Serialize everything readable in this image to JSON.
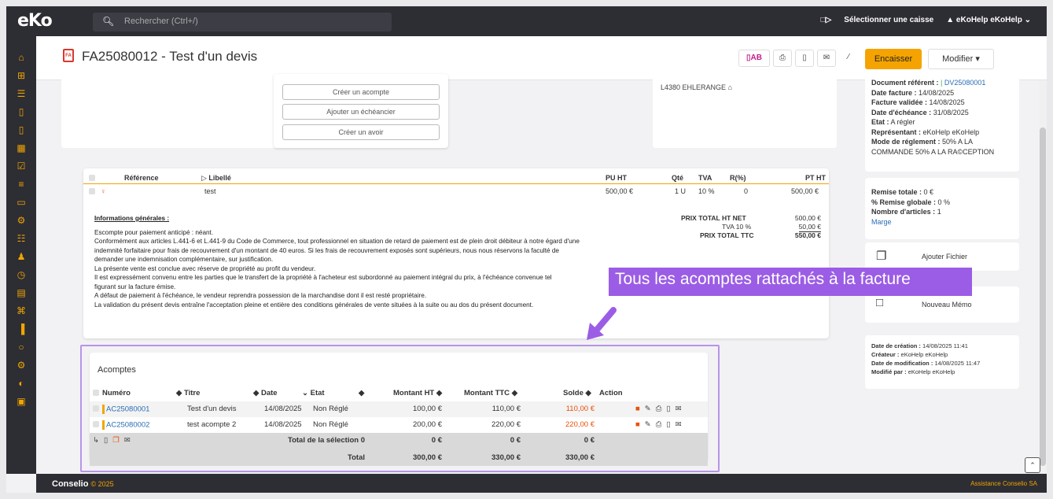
{
  "app": {
    "logo": "eKo",
    "search_placeholder": "Rechercher (Ctrl+/)",
    "select_register": "Sélectionner une caisse",
    "user": "eKoHelp eKoHelp"
  },
  "sidebar": {
    "icons": [
      "home-icon",
      "grid-icon",
      "list-icon",
      "document-icon",
      "document-add-icon",
      "calendar-icon",
      "calendar-check-icon",
      "list-numbered-icon",
      "folder-icon",
      "settings-list-icon",
      "sitemap-icon",
      "people-icon",
      "clock-icon",
      "receipt-icon",
      "network-icon",
      "chart-icon",
      "search-icon",
      "gear-icon",
      "palette-icon",
      "calculator-icon"
    ]
  },
  "header": {
    "title": "FA25080012 - Test d'un devis",
    "ab": "AB",
    "encaisser": "Encaisser",
    "modifier": "Modifier"
  },
  "actions": {
    "acompte": "Créer un acompte",
    "echeancier": "Ajouter un échéancier",
    "avoir": "Créer un avoir"
  },
  "address": {
    "city": "L4380 EHLERANGE"
  },
  "info": {
    "doc_ref_label": "Document référent :",
    "doc_ref": "DV25080001",
    "date_facture_label": "Date facture :",
    "date_facture": "14/08/2025",
    "validee_label": "Facture validée :",
    "validee": "14/08/2025",
    "echeance_label": "Date d'échéance :",
    "echeance": "31/08/2025",
    "etat_label": "Etat :",
    "etat": "A régler",
    "rep_label": "Représentant :",
    "rep": "eKoHelp eKoHelp",
    "mode_label": "Mode de réglement :",
    "mode": "50% A  LA COMMANDE 50% A  LA RA©CEPTION"
  },
  "totals_side": {
    "remise_label": "Remise totale :",
    "remise": "0 €",
    "remise_glob_label": "% Remise globale :",
    "remise_glob": "0 %",
    "nb_label": "Nombre d'articles :",
    "nb": "1",
    "marge": "Marge"
  },
  "ajouter_fichier": "Ajouter Fichier",
  "nouveau_memo": "Nouveau Mémo",
  "meta": {
    "creation_label": "Date de création :",
    "creation": "14/08/2025 11:41",
    "createur_label": "Créateur :",
    "createur": "eKoHelp eKoHelp",
    "modif_label": "Date de modification :",
    "modif": "14/08/2025 11:47",
    "modifie_label": "Modifié par :",
    "modifie": "eKoHelp eKoHelp"
  },
  "lines": {
    "headers": {
      "ref": "Référence",
      "lib": "Libellé",
      "pu": "PU HT",
      "qte": "Qté",
      "tva": "TVA",
      "r": "R(%)",
      "pt": "PT HT"
    },
    "row": {
      "lib": "test",
      "pu": "500,00 €",
      "qte": "1 U",
      "tva": "10 %",
      "r": "0",
      "pt": "500,00 €"
    }
  },
  "summary": {
    "net_label": "PRIX TOTAL HT NET",
    "net": "500,00 €",
    "tva_label": "TVA 10 %",
    "tva": "50,00 €",
    "ttc_label": "PRIX TOTAL TTC",
    "ttc": "550,00 €"
  },
  "general": {
    "title": "Informations générales :",
    "l1": "Escompte pour paiement anticipé : néant.",
    "l2": "Conformément aux articles L.441-6 et L.441-9 du Code de Commerce, tout professionnel en situation de retard de paiement est de plein droit débiteur à notre égard d'une",
    "l3": "indemnité forfaitaire pour frais de recouvrement d'un montant de 40 euros. Si les frais de recouvrement exposés sont supérieurs, nous nous réservons la faculté de",
    "l4": "demander une indemnisation complémentaire, sur justification.",
    "l5": "La présente vente est conclue avec réserve de propriété au profit du vendeur.",
    "l6": "Il est expressément convenu entre les parties que le transfert de la propriété à l'acheteur est subordonné au paiement intégral du prix, à l'échéance convenue tel",
    "l7": "figurant sur la facture émise.",
    "l8": "A défaut de paiement à l'échéance, le vendeur reprendra possession de la marchandise dont il est resté propriétaire.",
    "l9": "La validation du présent devis entraîne l'acceptation pleine et entière des conditions générales de vente situées à la suite ou au dos du présent document."
  },
  "callout": "Tous les acomptes rattachés à la facture",
  "acomptes": {
    "title": "Acomptes",
    "headers": {
      "num": "Numéro",
      "titre": "Titre",
      "date": "Date",
      "etat": "Etat",
      "ht": "Montant HT",
      "ttc": "Montant TTC",
      "solde": "Solde",
      "action": "Action"
    },
    "rows": [
      {
        "num": "AC25080001",
        "titre": "Test d'un devis",
        "date": "14/08/2025",
        "etat": "Non Réglé",
        "ht": "100,00 €",
        "ttc": "110,00 €",
        "solde": "110,00 €"
      },
      {
        "num": "AC25080002",
        "titre": "test acompte 2",
        "date": "14/08/2025",
        "etat": "Non Réglé",
        "ht": "200,00 €",
        "ttc": "220,00 €",
        "solde": "220,00 €"
      }
    ],
    "selection": {
      "label": "Total de la sélection 0",
      "ht": "0 €",
      "ttc": "0 €",
      "solde": "0 €"
    },
    "total": {
      "label": "Total",
      "ht": "300,00 €",
      "ttc": "330,00 €",
      "solde": "330,00 €"
    }
  },
  "footer": {
    "brand": "Conselio",
    "year": "© 2025",
    "assist": "Assistance Conselio SA"
  }
}
